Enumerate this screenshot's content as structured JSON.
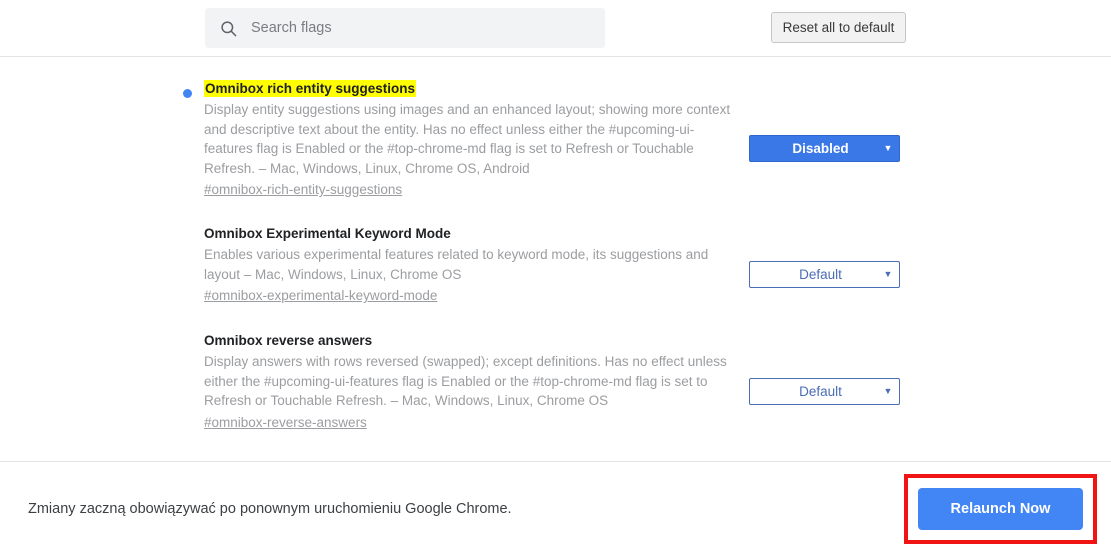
{
  "header": {
    "search": {
      "placeholder": "Search flags",
      "value": "",
      "icon": "search-icon"
    },
    "reset_button_label": "Reset all to default"
  },
  "flags": [
    {
      "title": "Omnibox rich entity suggestions",
      "highlighted": true,
      "has_dot": true,
      "description": "Display entity suggestions using images and an enhanced layout; showing more context and descriptive text about the entity. Has no effect unless either the #upcoming-ui-features flag is Enabled or the #top-chrome-md flag is set to Refresh or Touchable Refresh. – Mac, Windows, Linux, Chrome OS, Android",
      "permalink": "#omnibox-rich-entity-suggestions",
      "select_value": "Disabled",
      "select_state": "disabled"
    },
    {
      "title": "Omnibox Experimental Keyword Mode",
      "highlighted": false,
      "has_dot": false,
      "description": "Enables various experimental features related to keyword mode, its suggestions and layout – Mac, Windows, Linux, Chrome OS",
      "permalink": "#omnibox-experimental-keyword-mode",
      "select_value": "Default",
      "select_state": "default"
    },
    {
      "title": "Omnibox reverse answers",
      "highlighted": false,
      "has_dot": false,
      "description": "Display answers with rows reversed (swapped); except definitions. Has no effect unless either the #upcoming-ui-features flag is Enabled or the #top-chrome-md flag is set to Refresh or Touchable Refresh. – Mac, Windows, Linux, Chrome OS",
      "permalink": "#omnibox-reverse-answers",
      "select_value": "Default",
      "select_state": "default"
    }
  ],
  "select_arrow_glyph": "▼",
  "footer": {
    "note": "Zmiany zaczną obowiązywać po ponownym uruchomieniu Google Chrome.",
    "relaunch_button_label": "Relaunch Now"
  },
  "colors": {
    "accent_blue": "#4285f4",
    "select_blue": "#3b78e7",
    "select_outline_blue": "#4a6db5",
    "highlight_yellow": "#ffff00",
    "annotation_red": "#f01414",
    "search_background": "#f1f3f4",
    "description_gray": "#9b9da0"
  }
}
